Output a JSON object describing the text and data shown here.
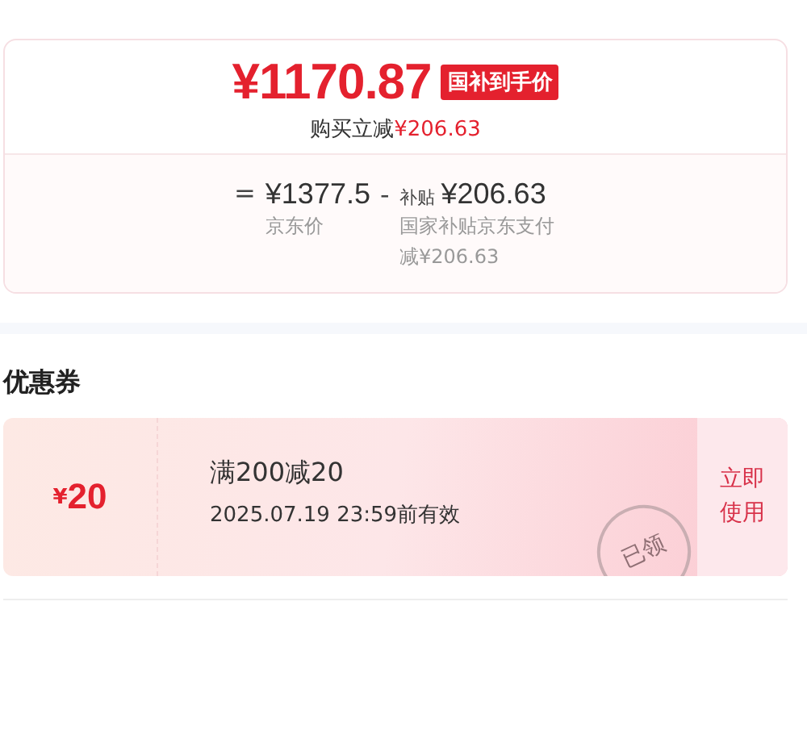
{
  "price_card": {
    "final_price": "¥1170.87",
    "badge": "国补到手价",
    "instant_discount_label": "购买立减",
    "instant_discount_value": "¥206.63",
    "breakdown": {
      "equals": "=",
      "base_price": "¥1377.5",
      "base_label": "京东价",
      "minus": "-",
      "subsidy_tag": "补贴",
      "subsidy_price": "¥206.63",
      "subsidy_label": "国家补贴京东支付减¥206.63"
    }
  },
  "coupons_section": {
    "title": "优惠券",
    "coupons": [
      {
        "currency": "¥",
        "amount": "20",
        "condition": "满200减20",
        "validity": "2025.07.19 23:59前有效",
        "stamp": "已领",
        "action": "立即使用"
      }
    ]
  }
}
